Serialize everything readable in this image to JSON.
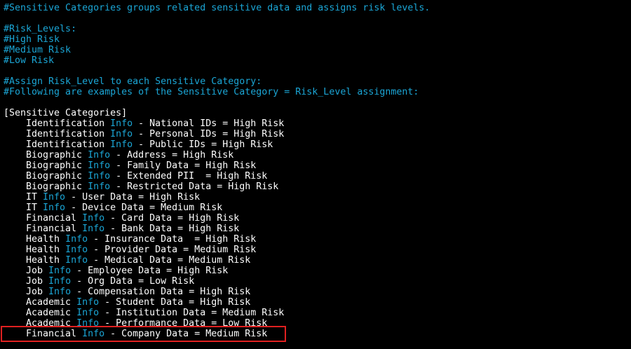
{
  "comments": {
    "line1": "#Sensitive Categories groups related sensitive data and assigns risk levels.",
    "line2": "#Risk_Levels:",
    "line3": "#High Risk",
    "line4": "#Medium Risk",
    "line5": "#Low Risk",
    "line6": "#Assign Risk_Level to each Sensitive Category:",
    "line7": "#Following are examples of the Sensitive Category = Risk_Level assignment:"
  },
  "section_header": "[Sensitive Categories]",
  "keyword": "Info",
  "entries": [
    {
      "category": "Identification",
      "rest": " - National IDs = High Risk"
    },
    {
      "category": "Identification",
      "rest": " - Personal IDs = High Risk"
    },
    {
      "category": "Identification",
      "rest": " - Public IDs = High Risk"
    },
    {
      "category": "Biographic",
      "rest": " - Address = High Risk"
    },
    {
      "category": "Biographic",
      "rest": " - Family Data = High Risk"
    },
    {
      "category": "Biographic",
      "rest": " - Extended PII  = High Risk"
    },
    {
      "category": "Biographic",
      "rest": " - Restricted Data = High Risk"
    },
    {
      "category": "IT",
      "rest": " - User Data = High Risk"
    },
    {
      "category": "IT",
      "rest": " - Device Data = Medium Risk"
    },
    {
      "category": "Financial",
      "rest": " - Card Data = High Risk"
    },
    {
      "category": "Financial",
      "rest": " - Bank Data = High Risk"
    },
    {
      "category": "Health",
      "rest": " - Insurance Data  = High Risk"
    },
    {
      "category": "Health",
      "rest": " - Provider Data = Medium Risk"
    },
    {
      "category": "Health",
      "rest": " - Medical Data = Medium Risk"
    },
    {
      "category": "Job",
      "rest": " - Employee Data = High Risk"
    },
    {
      "category": "Job",
      "rest": " - Org Data = Low Risk"
    },
    {
      "category": "Job",
      "rest": " - Compensation Data = High Risk"
    },
    {
      "category": "Academic",
      "rest": " - Student Data = High Risk"
    },
    {
      "category": "Academic",
      "rest": " - Institution Data = Medium Risk"
    },
    {
      "category": "Academic",
      "rest": " - Performance Data = Low Risk"
    },
    {
      "category": "Financial",
      "rest": " - Company Data = Medium Risk"
    }
  ],
  "colors": {
    "background": "#000000",
    "comment": "#1ba6d6",
    "text": "#ffffff",
    "highlight_border": "#e02020"
  }
}
